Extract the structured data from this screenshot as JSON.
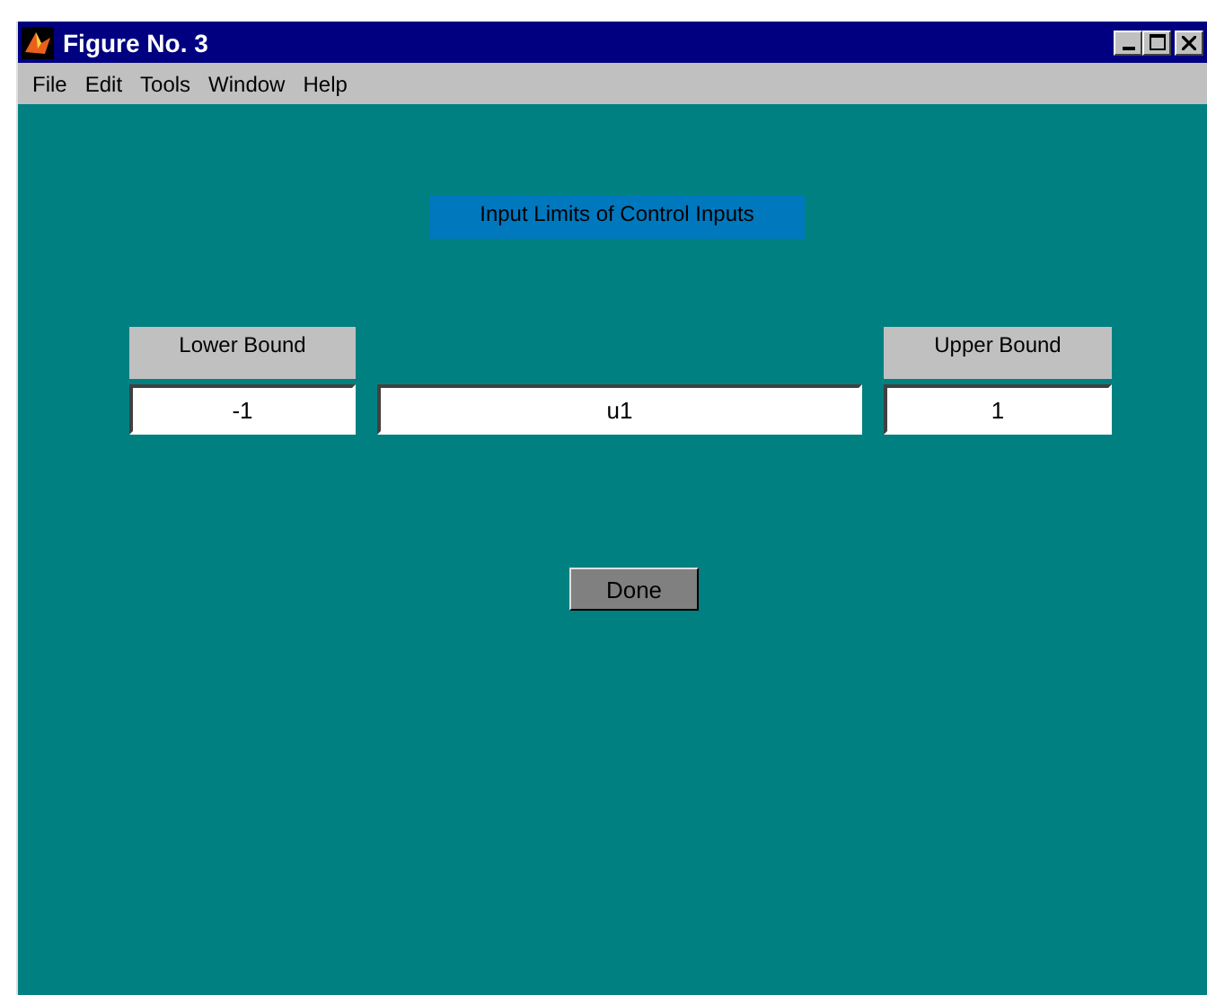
{
  "window": {
    "title": "Figure No. 3"
  },
  "menu": [
    {
      "label": "File"
    },
    {
      "label": "Edit"
    },
    {
      "label": "Tools"
    },
    {
      "label": "Window"
    },
    {
      "label": "Help"
    }
  ],
  "heading": "Input Limits of Control Inputs",
  "lower_bound": {
    "label": "Lower Bound",
    "value": "-1"
  },
  "input_name": {
    "value": "u1"
  },
  "upper_bound": {
    "label": "Upper Bound",
    "value": "1"
  },
  "buttons": [
    {
      "label": "Done"
    }
  ]
}
